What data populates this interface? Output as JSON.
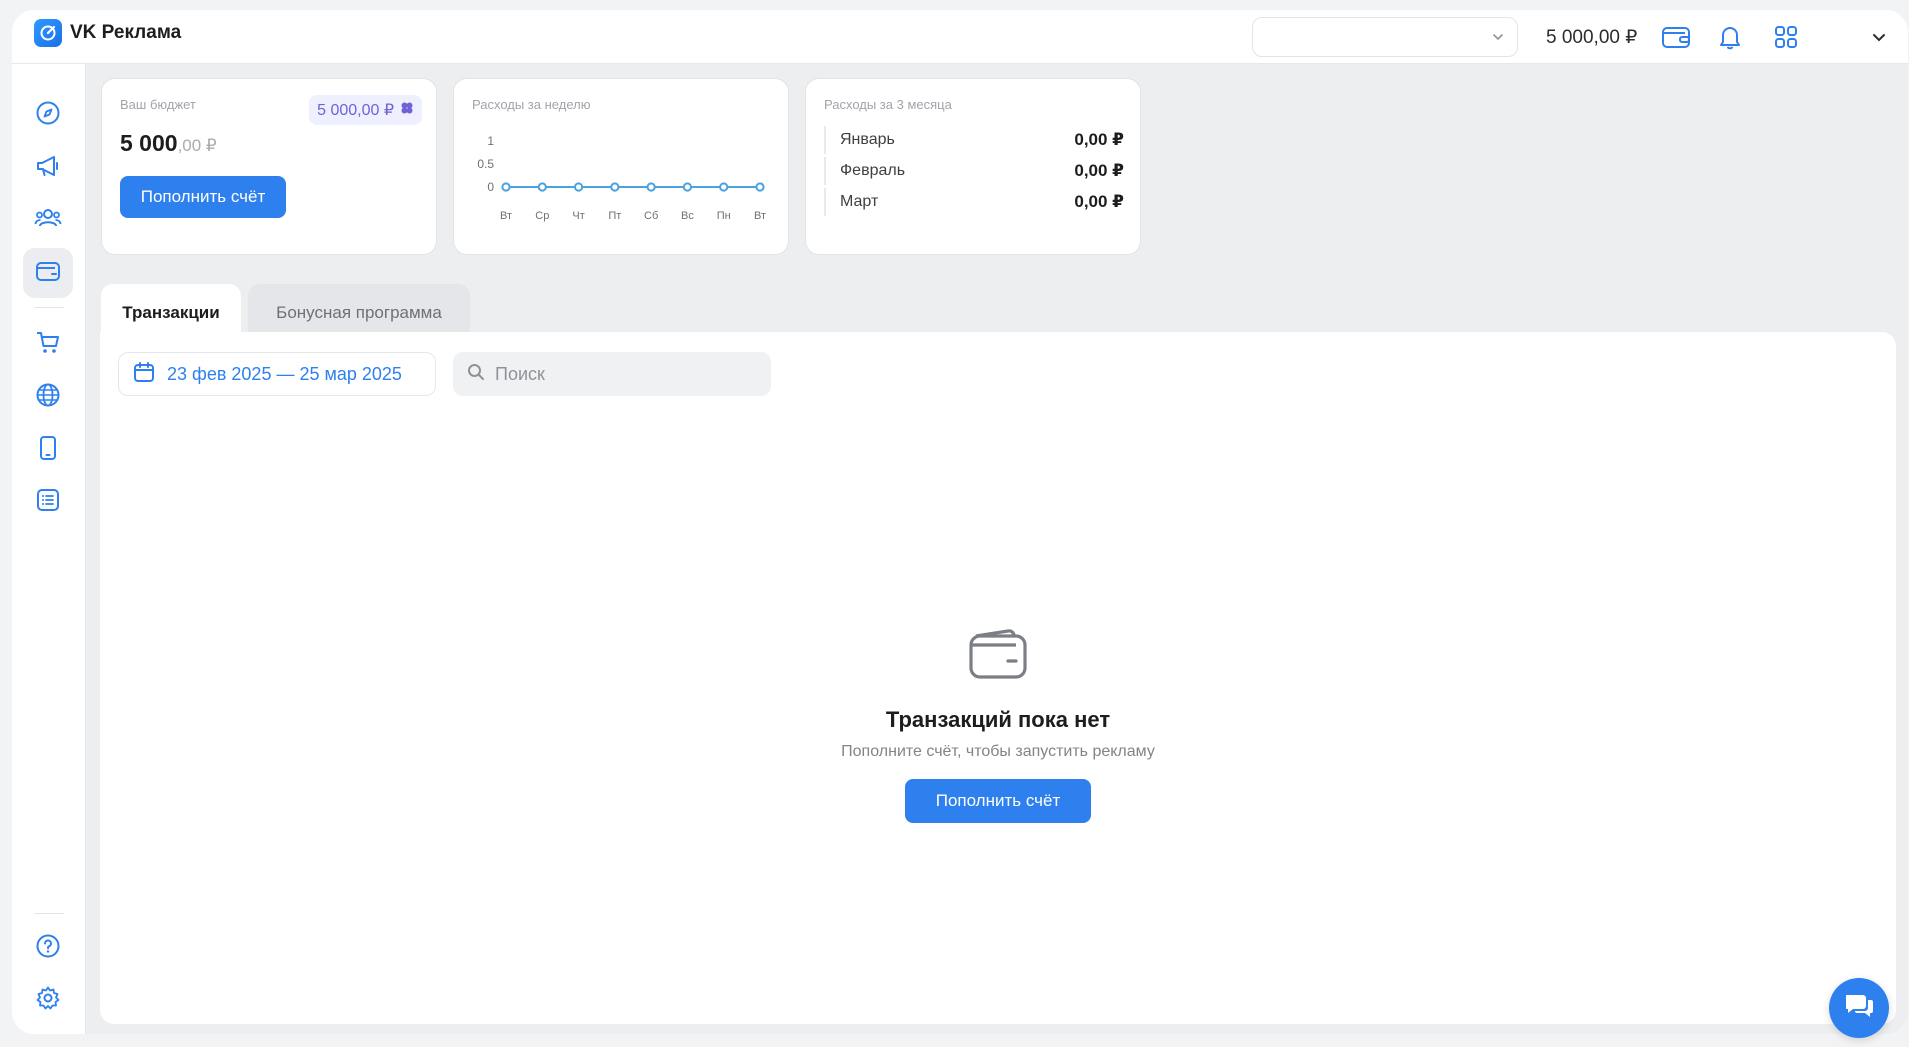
{
  "app": {
    "title": "VK Реклама"
  },
  "topbar": {
    "account_select_value": "",
    "balance": "5 000,00 ₽",
    "wallet_icon": "wallet-icon",
    "bell_icon": "bell-icon",
    "apps_icon": "grid-icon",
    "menu_chevron_icon": "chevron-down-icon"
  },
  "sidebar": {
    "items": [
      {
        "icon": "compass-icon",
        "active": false
      },
      {
        "icon": "megaphone-icon",
        "active": false
      },
      {
        "icon": "users-icon",
        "active": false
      },
      {
        "icon": "wallet-icon",
        "active": true
      },
      {
        "icon": "cart-icon",
        "active": false
      },
      {
        "icon": "globe-icon",
        "active": false
      },
      {
        "icon": "phone-icon",
        "active": false
      },
      {
        "icon": "list-icon",
        "active": false
      },
      {
        "icon": "help-icon",
        "active": false
      },
      {
        "icon": "gear-icon",
        "active": false
      }
    ]
  },
  "budget_card": {
    "title": "Ваш бюджет",
    "amount_main": "5 000",
    "amount_kop": ",00 ₽",
    "bonus_badge": "5 000,00 ₽",
    "topup_label": "Пополнить счёт"
  },
  "week_card": {
    "title": "Расходы за неделю"
  },
  "chart_data": {
    "type": "line",
    "title": "Расходы за неделю",
    "x": [
      "Вт",
      "Ср",
      "Чт",
      "Пт",
      "Сб",
      "Вс",
      "Пн",
      "Вт"
    ],
    "series": [
      {
        "values": [
          0,
          0,
          0,
          0,
          0,
          0,
          0,
          0
        ]
      }
    ],
    "y_ticks": [
      "1",
      "0.5",
      "0"
    ],
    "ylim": [
      0,
      1
    ],
    "xlabel": "",
    "ylabel": "",
    "grid": false,
    "color": "#4aa3df"
  },
  "months_card": {
    "title": "Расходы за 3 месяца",
    "rows": [
      {
        "month": "Январь",
        "value": "0,00 ₽"
      },
      {
        "month": "Февраль",
        "value": "0,00 ₽"
      },
      {
        "month": "Март",
        "value": "0,00 ₽"
      }
    ]
  },
  "tabs": [
    {
      "label": "Транзакции",
      "active": true
    },
    {
      "label": "Бонусная программа",
      "active": false
    }
  ],
  "filters": {
    "date_range": "23 фев 2025 — 25 мар 2025",
    "search_placeholder": "Поиск"
  },
  "empty_state": {
    "icon": "wallet-icon",
    "title": "Транзакций пока нет",
    "subtitle": "Пополните счёт, чтобы запустить рекламу",
    "button_label": "Пополнить счёт"
  },
  "chat": {
    "icon": "chat-icon"
  },
  "colors": {
    "accent": "#2d80ed",
    "badge_text": "#6e62d6",
    "badge_bg": "#eef0ff"
  }
}
